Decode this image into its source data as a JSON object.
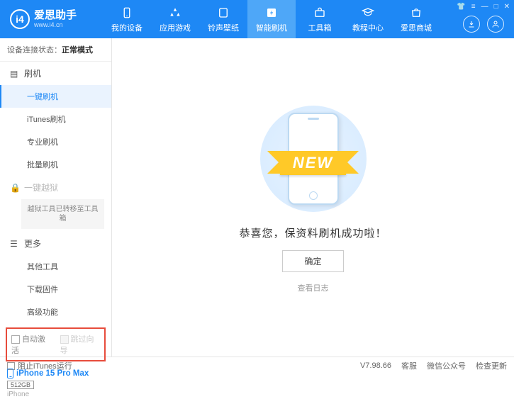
{
  "app": {
    "name": "爱思助手",
    "url": "www.i4.cn"
  },
  "topnav": [
    {
      "label": "我的设备"
    },
    {
      "label": "应用游戏"
    },
    {
      "label": "铃声壁纸"
    },
    {
      "label": "智能刷机"
    },
    {
      "label": "工具箱"
    },
    {
      "label": "教程中心"
    },
    {
      "label": "爱思商城"
    }
  ],
  "sidebar": {
    "status_label": "设备连接状态：",
    "status_value": "正常模式",
    "flash_header": "刷机",
    "flash_items": [
      "一键刷机",
      "iTunes刷机",
      "专业刷机",
      "批量刷机"
    ],
    "jailbreak_header": "一键越狱",
    "jailbreak_note": "越狱工具已转移至工具箱",
    "more_header": "更多",
    "more_items": [
      "其他工具",
      "下载固件",
      "高级功能"
    ],
    "check_auto_activate": "自动激活",
    "check_skip_guide": "跳过向导",
    "device_name": "iPhone 15 Pro Max",
    "device_storage": "512GB",
    "device_type": "iPhone"
  },
  "main": {
    "ribbon": "NEW",
    "message": "恭喜您，保资料刷机成功啦！",
    "ok": "确定",
    "view_log": "查看日志"
  },
  "statusbar": {
    "block_itunes": "阻止iTunes运行",
    "version": "V7.98.66",
    "links": [
      "客服",
      "微信公众号",
      "检查更新"
    ]
  }
}
